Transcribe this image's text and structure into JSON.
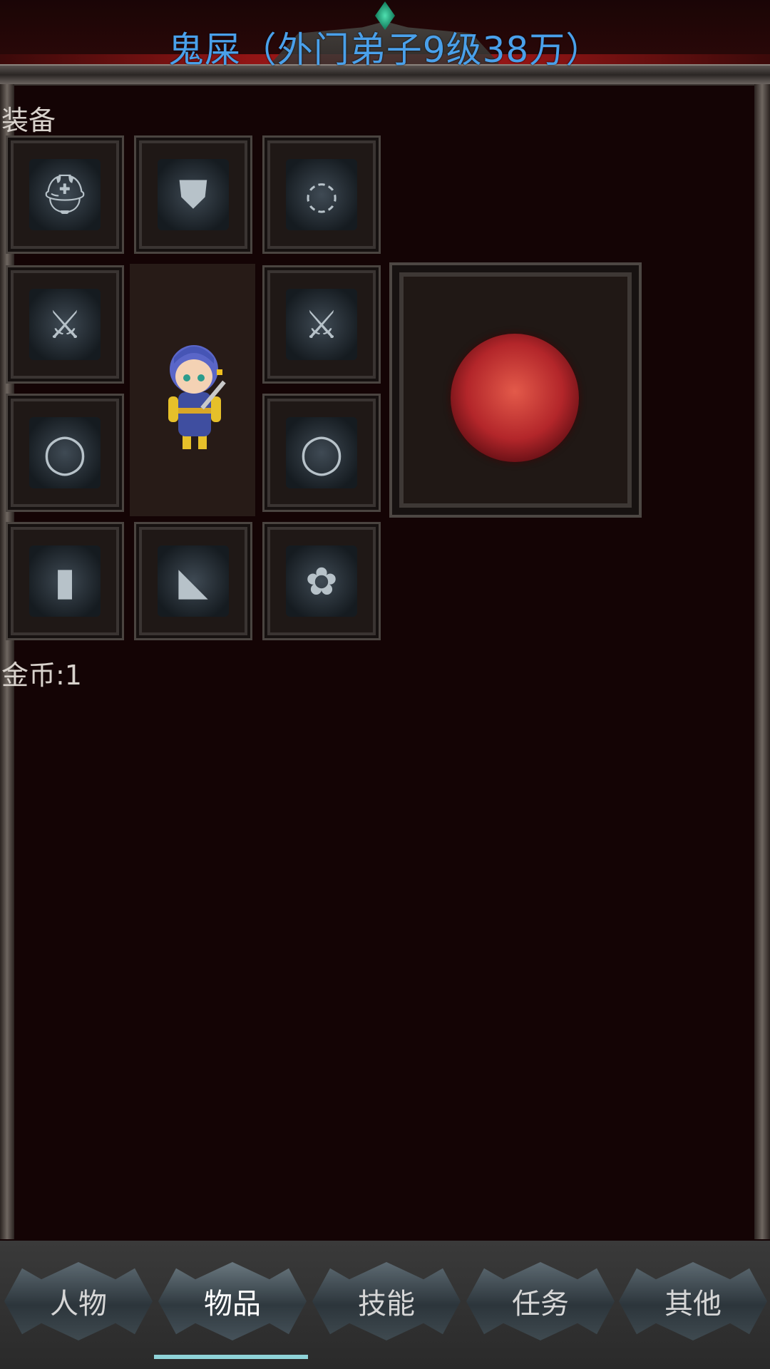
{
  "header": {
    "title": "鬼屎（外门弟子9级38万）"
  },
  "equipment": {
    "label": "装备",
    "slots": [
      {
        "icon": "helmet-icon"
      },
      {
        "icon": "armor-icon"
      },
      {
        "icon": "necklace-icon"
      },
      {
        "icon": "weapon-icon"
      },
      {
        "icon": "weapon-icon"
      },
      {
        "icon": "ring-icon"
      },
      {
        "icon": "ring-icon"
      },
      {
        "icon": "bracer-icon"
      },
      {
        "icon": "boots-icon"
      },
      {
        "icon": "amulet-icon"
      }
    ],
    "special_slot": {
      "icon": "tiger-emblem-icon"
    }
  },
  "gold": {
    "text": "金币:1"
  },
  "nav": {
    "tabs": [
      "人物",
      "物品",
      "技能",
      "任务",
      "其他"
    ],
    "active_index": 1
  },
  "colors": {
    "title": "#4aa0ea",
    "background": "#140405",
    "indicator": "#8fd3d8"
  }
}
